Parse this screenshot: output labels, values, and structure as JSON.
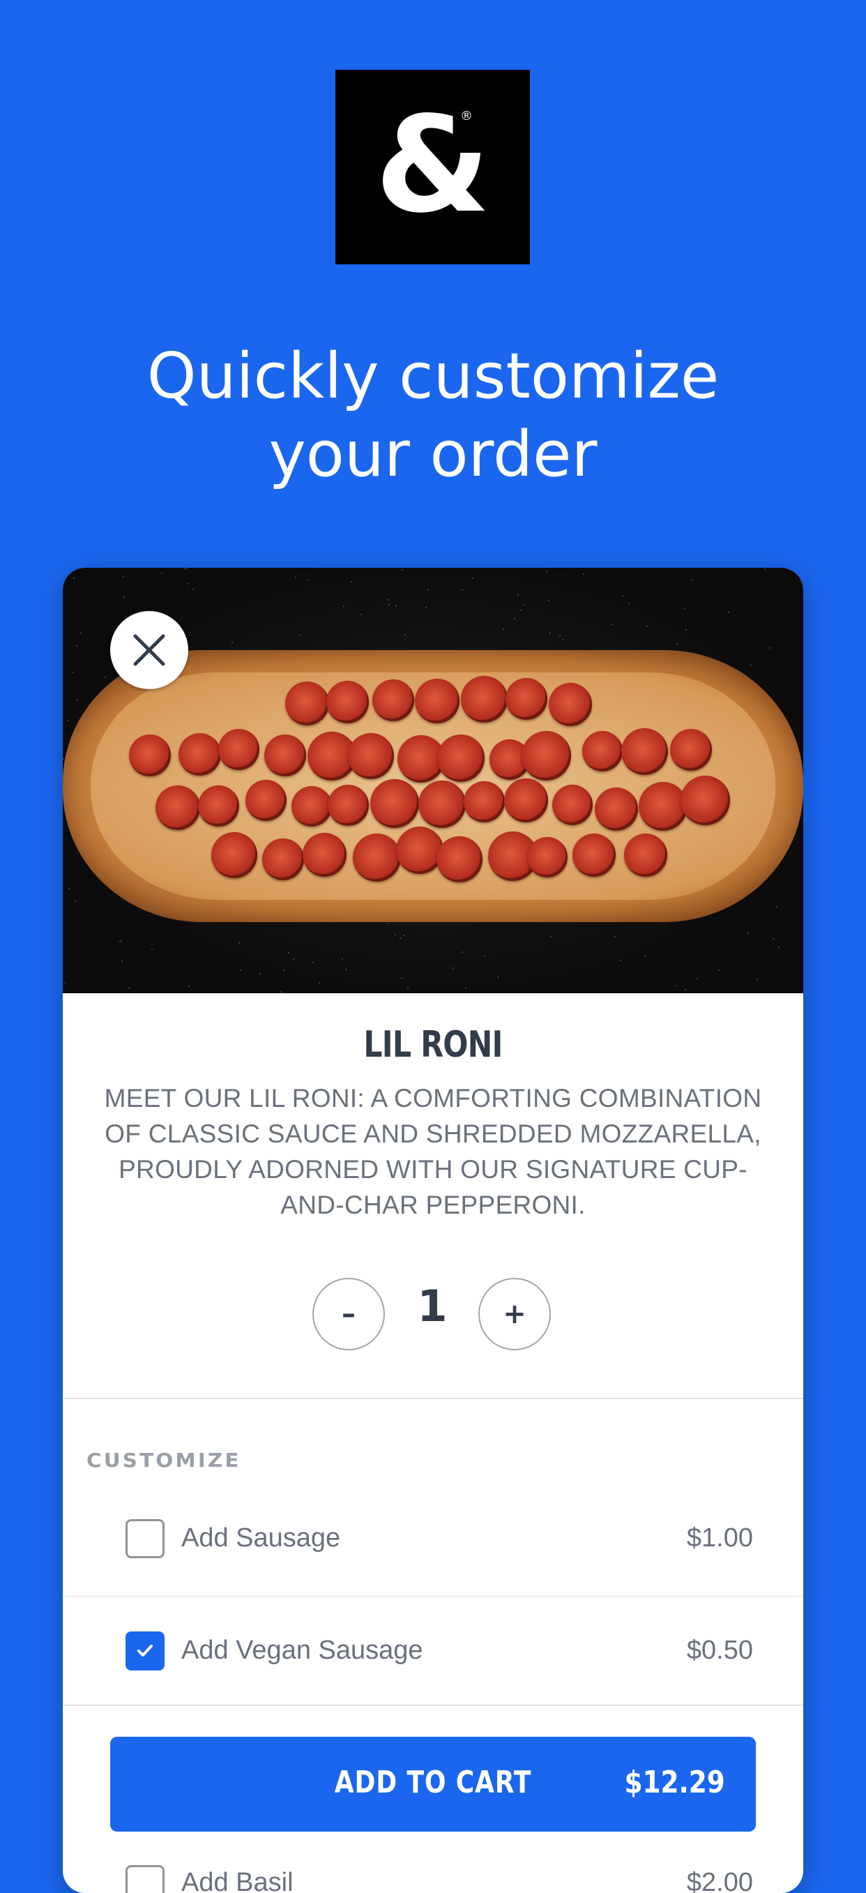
{
  "brand": {
    "logo_glyph": "&",
    "logo_mark": "®"
  },
  "headline": {
    "line1": "Quickly customize",
    "line2": "your order"
  },
  "product": {
    "title": "LIL RONI",
    "description": "MEET OUR LIL RONI: A COMFORTING COMBINATION OF CLASSIC SAUCE AND SHREDDED MOZZARELLA, PROUDLY ADORNED WITH OUR SIGNATURE CUP-AND-CHAR PEPPERONI."
  },
  "quantity": {
    "minus": "–",
    "value": "1",
    "plus": "+"
  },
  "customize": {
    "label": "CUSTOMIZE",
    "options": [
      {
        "label": "Add Sausage",
        "price": "$1.00",
        "checked": false
      },
      {
        "label": "Add Vegan Sausage",
        "price": "$0.50",
        "checked": true
      },
      {
        "label": "Add Basil",
        "price": "$2.00",
        "checked": false
      }
    ]
  },
  "cart": {
    "label": "ADD TO CART",
    "price": "$12.29"
  },
  "colors": {
    "brand_blue": "#1a66ee",
    "text_dark": "#333c4a",
    "text_muted": "#6a717c"
  }
}
